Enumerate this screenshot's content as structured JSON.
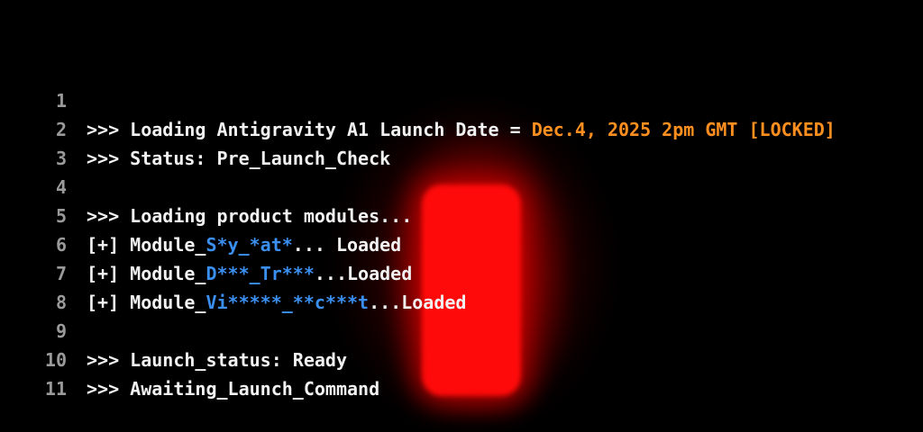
{
  "colors": {
    "background": "#000000",
    "text": "#f2f2f2",
    "line_number": "#9a9a9a",
    "highlight_orange": "#ff8f1f",
    "highlight_blue": "#3a8ff0",
    "glow_red": "#ff0a0a"
  },
  "terminal": {
    "lines": [
      {
        "num": "1",
        "segments": [
          {
            "text": ">>> Loading Antigravity A1 Launch Date = ",
            "color": "default"
          },
          {
            "text": "Dec.4, 2025 2pm GMT [LOCKED]",
            "color": "orange"
          }
        ]
      },
      {
        "num": "2",
        "segments": [
          {
            "text": ">>> Status: Pre_Launch_Check",
            "color": "default"
          }
        ]
      },
      {
        "num": "3",
        "segments": []
      },
      {
        "num": "4",
        "segments": [
          {
            "text": ">>> Loading product modules...",
            "color": "default"
          }
        ]
      },
      {
        "num": "5",
        "segments": [
          {
            "text": "[+] Module_",
            "color": "default"
          },
          {
            "text": "S*y_*at*",
            "color": "blue"
          },
          {
            "text": "... Loaded",
            "color": "default"
          }
        ]
      },
      {
        "num": "6",
        "segments": [
          {
            "text": "[+] Module_",
            "color": "default"
          },
          {
            "text": "D***_Tr***",
            "color": "blue"
          },
          {
            "text": "...Loaded",
            "color": "default"
          }
        ]
      },
      {
        "num": "7",
        "segments": [
          {
            "text": "[+] Module_",
            "color": "default"
          },
          {
            "text": "Vi*****_**c***t",
            "color": "blue"
          },
          {
            "text": "...Loaded",
            "color": "default"
          }
        ]
      },
      {
        "num": "8",
        "segments": []
      },
      {
        "num": "9",
        "segments": [
          {
            "text": ">>> Launch_status: Ready",
            "color": "default"
          }
        ]
      },
      {
        "num": "10",
        "segments": [
          {
            "text": ">>> Awaiting_Launch_Command",
            "color": "default"
          }
        ]
      },
      {
        "num": "11",
        "segments": []
      }
    ]
  }
}
